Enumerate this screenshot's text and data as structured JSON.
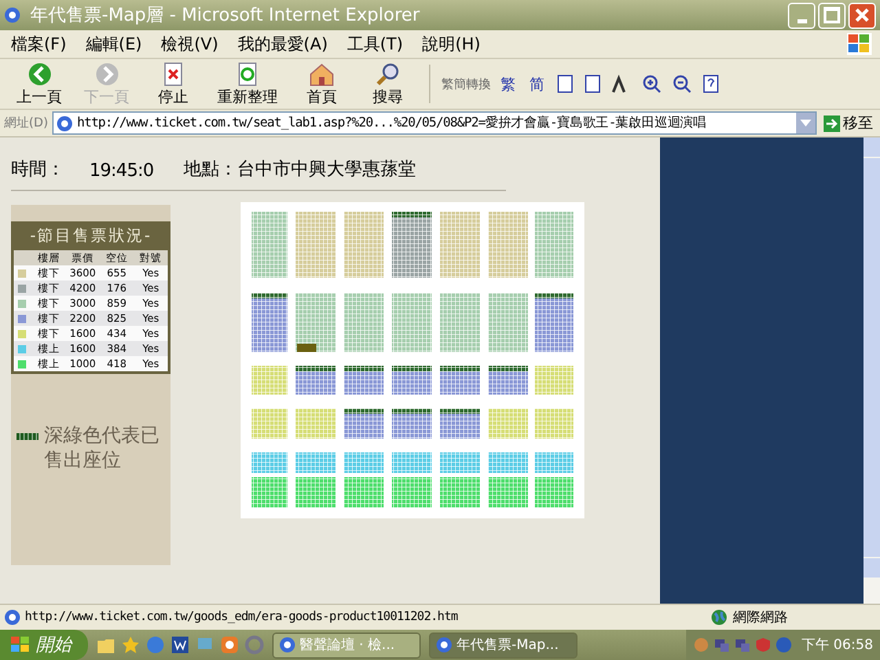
{
  "window": {
    "title": "年代售票-Map層 - Microsoft Internet Explorer"
  },
  "menu": [
    "檔案(F)",
    "編輯(E)",
    "檢視(V)",
    "我的最愛(A)",
    "工具(T)",
    "說明(H)"
  ],
  "toolbar": [
    {
      "label": "上一頁",
      "kind": "back",
      "disabled": false
    },
    {
      "label": "下一頁",
      "kind": "forward",
      "disabled": true
    },
    {
      "label": "停止",
      "kind": "stop",
      "disabled": false
    },
    {
      "label": "重新整理",
      "kind": "refresh",
      "disabled": false
    },
    {
      "label": "首頁",
      "kind": "home",
      "disabled": false
    },
    {
      "label": "搜尋",
      "kind": "search",
      "disabled": false
    }
  ],
  "convert_bar": {
    "label": "繁簡轉換",
    "traditional": "繁",
    "simplified": "简"
  },
  "address_bar": {
    "label": "網址(D)",
    "value": "http://www.ticket.com.tw/seat_lab1.asp?%20...%20/05/08&P2=愛拚才會贏-寶島歌王-葉啟田巡迴演唱",
    "go": "移至"
  },
  "event": {
    "time_label": "時間：",
    "time": "19:45:0",
    "place": "地點：台中市中興大學惠蓀堂"
  },
  "legend": {
    "title": "-節目售票狀況-",
    "columns": [
      "樓層",
      "票價",
      "空位",
      "對號"
    ],
    "rows": [
      {
        "color": "#d6cd9c",
        "floor": "樓下",
        "price": "3600",
        "empty": "655",
        "numbered": "Yes"
      },
      {
        "color": "#9aa4a4",
        "floor": "樓下",
        "price": "4200",
        "empty": "176",
        "numbered": "Yes"
      },
      {
        "color": "#a6ceae",
        "floor": "樓下",
        "price": "3000",
        "empty": "859",
        "numbered": "Yes"
      },
      {
        "color": "#8a98d6",
        "floor": "樓下",
        "price": "2200",
        "empty": "825",
        "numbered": "Yes"
      },
      {
        "color": "#d6de76",
        "floor": "樓下",
        "price": "1600",
        "empty": "434",
        "numbered": "Yes"
      },
      {
        "color": "#5ccde6",
        "floor": "樓上",
        "price": "1600",
        "empty": "384",
        "numbered": "Yes"
      },
      {
        "color": "#4ede6c",
        "floor": "樓上",
        "price": "1000",
        "empty": "418",
        "numbered": "Yes"
      }
    ]
  },
  "note": "深綠色代表已售出座位",
  "status_bar": {
    "url": "http://www.ticket.com.tw/goods_edm/era-goods-product10011202.htm",
    "zone": "網際網路"
  },
  "taskbar": {
    "start": "開始",
    "tasks": [
      {
        "label": "醫聲論壇 · 檢...",
        "selected": false
      },
      {
        "label": "年代售票-Map...",
        "selected": true
      }
    ],
    "clock": "下午 06:58"
  }
}
